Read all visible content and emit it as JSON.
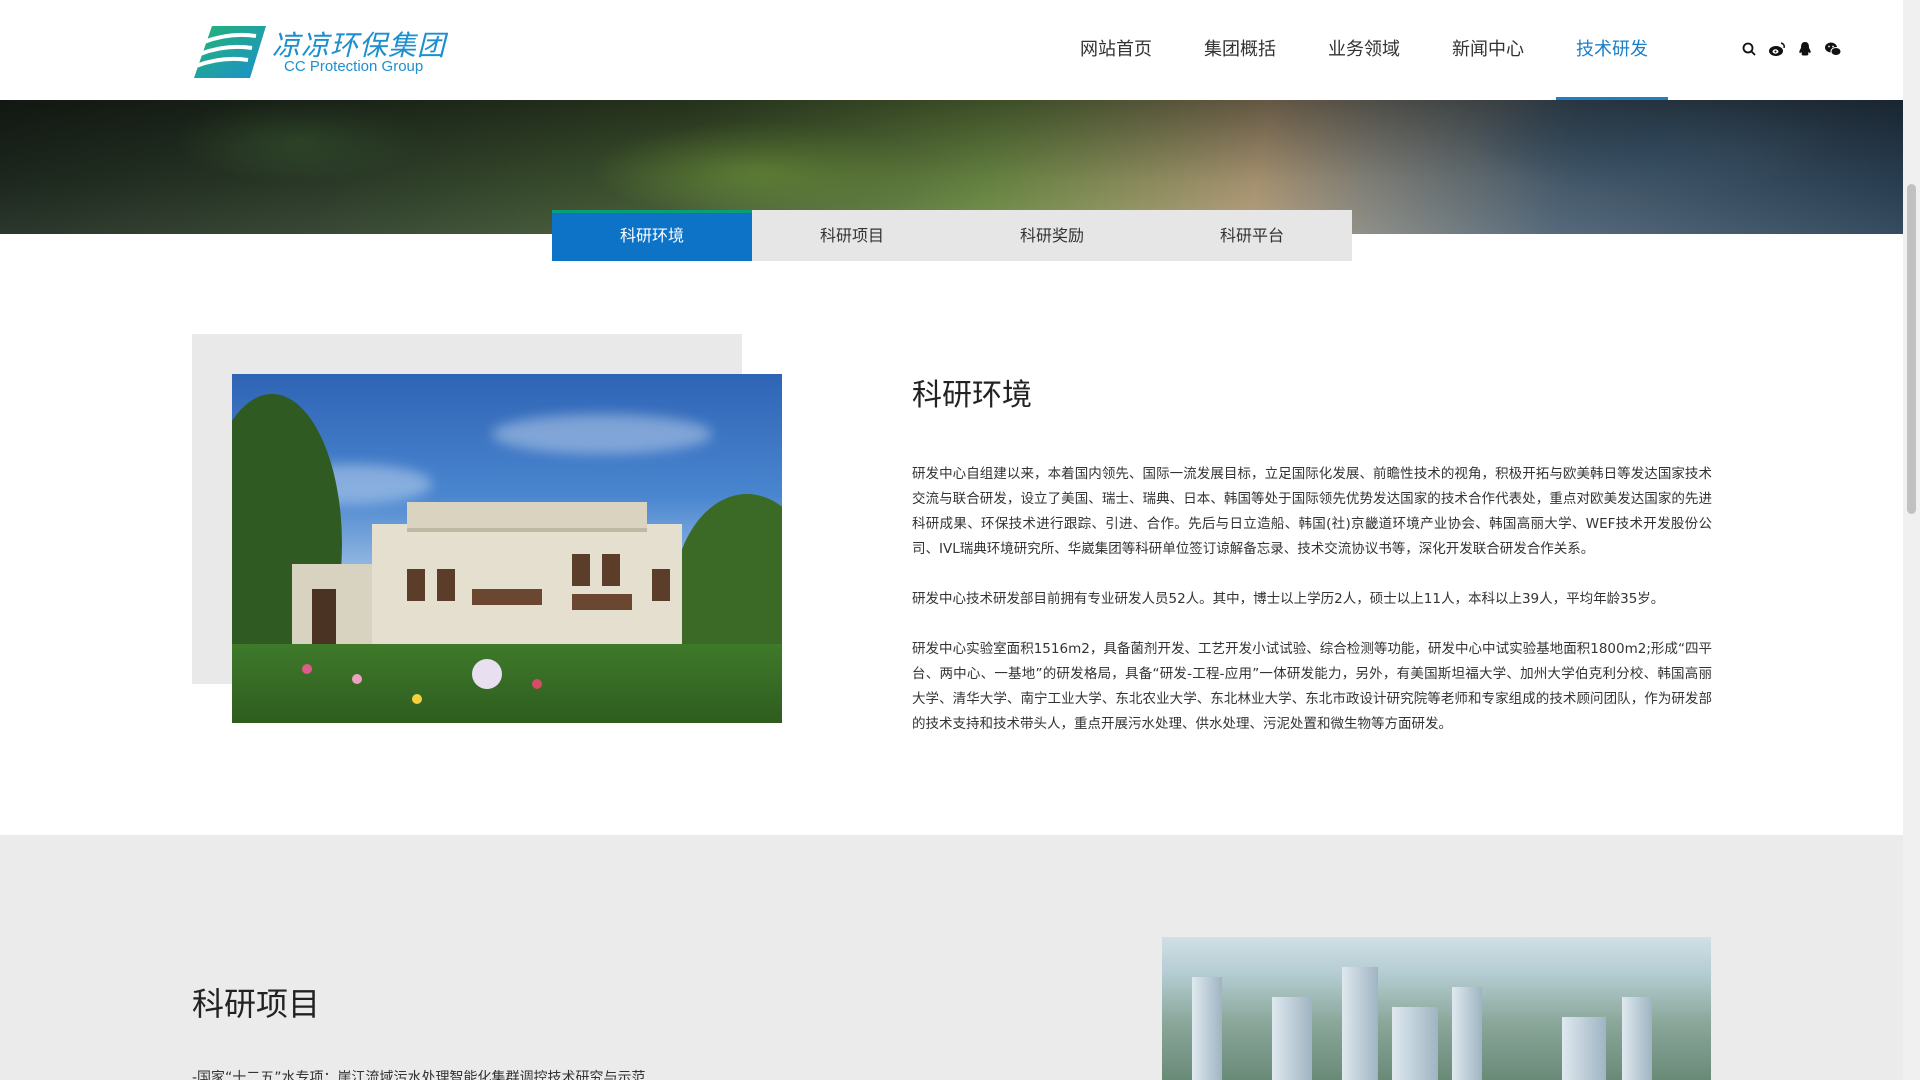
{
  "brand": {
    "name_cn": "凉凉环保集团",
    "name_en": "CC Protection Group",
    "color_primary": "#1d8fcf",
    "color_secondary": "#22b573"
  },
  "nav": {
    "items": [
      {
        "label": "网站首页",
        "active": false
      },
      {
        "label": "集团概括",
        "active": false
      },
      {
        "label": "业务领域",
        "active": false
      },
      {
        "label": "新闻中心",
        "active": false
      },
      {
        "label": "技术研发",
        "active": true
      }
    ],
    "active_color": "#1b7fc9",
    "tools": [
      "search-icon",
      "weibo-icon",
      "qq-icon",
      "wechat-icon"
    ]
  },
  "tabs": {
    "items": [
      {
        "label": "科研环境",
        "active": true
      },
      {
        "label": "科研项目",
        "active": false
      },
      {
        "label": "科研奖励",
        "active": false
      },
      {
        "label": "科研平台",
        "active": false
      }
    ],
    "active_color": "#0d73c7"
  },
  "section_environment": {
    "title": "科研环境",
    "paragraphs": [
      "研发中心自组建以来，本着国内领先、国际一流发展目标，立足国际化发展、前瞻性技术的视角，积极开拓与欧美韩日等发达国家技术交流与联合研发，设立了美国、瑞士、瑞典、日本、韩国等处于国际领先优势发达国家的技术合作代表处，重点对欧美发达国家的先进科研成果、环保技术进行跟踪、引进、合作。先后与日立造船、韩国(社)京畿道环境产业协会、韩国高丽大学、WEF技术开发股份公司、IVL瑞典环境研究所、华崴集团等科研单位签订谅解备忘录、技术交流协议书等，深化开发联合研发合作关系。",
      "研发中心技术研发部目前拥有专业研发人员52人。其中，博士以上学历2人，硕士以上11人，本科以上39人，平均年龄35岁。",
      "研发中心实验室面积1516m2，具备菌剂开发、工艺开发小试试验、综合检测等功能，研发中心中试实验基地面积1800m2;形成“四平台、两中心、一基地”的研发格局，具备“研发-工程-应用”一体研发能力，另外，有美国斯坦福大学、加州大学伯克利分校、韩国高丽大学、清华大学、南宁工业大学、东北农业大学、东北林业大学、东北市政设计研究院等老师和专家组成的技术顾问团队，作为研发部的技术支持和技术带头人，重点开展污水处理、供水处理、污泥处置和微生物等方面研发。"
    ]
  },
  "section_projects": {
    "title": "科研项目",
    "first_item": "-国家“十二五”水专项：崖江流域污水处理智能化集群调控技术研究与示范"
  }
}
